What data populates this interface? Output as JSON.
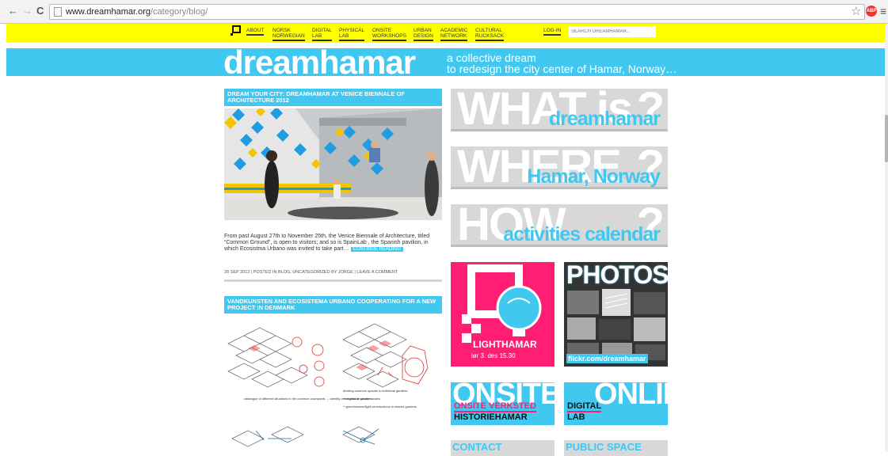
{
  "browser": {
    "url_host": "www.dreamhamar.org",
    "url_path": "/category/blog/",
    "back_icon": "←",
    "forward_icon": "→",
    "reload_icon": "C",
    "star_icon": "☆",
    "abp_label": "ABP",
    "menu_icon": "≡"
  },
  "nav": {
    "items": [
      {
        "line1": "About",
        "line2": ""
      },
      {
        "line1": "Norsk",
        "line2": "Norwegian"
      },
      {
        "line1": "Digital",
        "line2": "Lab"
      },
      {
        "line1": "Physical",
        "line2": "Lab"
      },
      {
        "line1": "Onsite",
        "line2": "Workshops"
      },
      {
        "line1": "Urban",
        "line2": "Design"
      },
      {
        "line1": "Academic",
        "line2": "Network"
      },
      {
        "line1": "Cultural",
        "line2": "Rucksack"
      }
    ],
    "login": "Log-in",
    "search_placeholder": "SEARCH DREAMHAMAR..."
  },
  "header": {
    "brand": "dreamhamar",
    "tagline_line1": "a collective dream",
    "tagline_line2": "to redesign the city center of Hamar, Norway…"
  },
  "posts": [
    {
      "title": "Dream your city: dreamhamar at Venice Biennale of Architecture 2012",
      "excerpt": "From past August 27th to November 25th, the Venice Biennale of Architecture, titled “Common Ground”, is open to visitors; and so is SpainLab , the Spanish pavilion, in which Ecosistma Urbano was invited to take part…",
      "continue": "Continue Reading",
      "meta": "28 Sep 2012 | Posted in Blog, Uncategorized by Jorge | Leave a comment"
    },
    {
      "title": "Vandkunsten and Ecosistema Urbano cooperating for a new project in Denmark",
      "caption_left": "catalogue of different situations in the common courtyards → identity orientation at smaller scales",
      "caption_right_1": "dividing common spaces in individual gardens",
      "caption_right_2": "+ vegetable gardens",
      "caption_right_3": "+ greenhouses/light constructions in shared gardens"
    }
  ],
  "panels": {
    "what": {
      "word": "WHAT is",
      "mark": "?",
      "answer": "dreamhamar"
    },
    "where": {
      "word": "WHERE",
      "mark": "?",
      "answer": "Hamar, Norway"
    },
    "how": {
      "word": "HOW",
      "mark": "?",
      "answer": "activities calendar"
    }
  },
  "tiles": {
    "lighthamar": {
      "label": "LIGHTHAMAR",
      "date": "lør 3. des 15.30"
    },
    "photos": {
      "title": "PHOTOS",
      "link": "flickr.com/dreamhamar"
    },
    "onsite": {
      "big": "ONSITE",
      "line1": "ONSITE VERKSTED",
      "line2": "HISTORIEHAMAR"
    },
    "online": {
      "big": "ONLINE",
      "line1": "DIGITAL",
      "line2": "LAB"
    },
    "contact": {
      "label": "CONTACT"
    },
    "public": {
      "label": "PUBLIC SPACE"
    }
  },
  "colors": {
    "yellow": "#ffff00",
    "cyan": "#40c8f0",
    "magenta": "#ff1e73",
    "panel_gray": "#d8d8d8"
  }
}
